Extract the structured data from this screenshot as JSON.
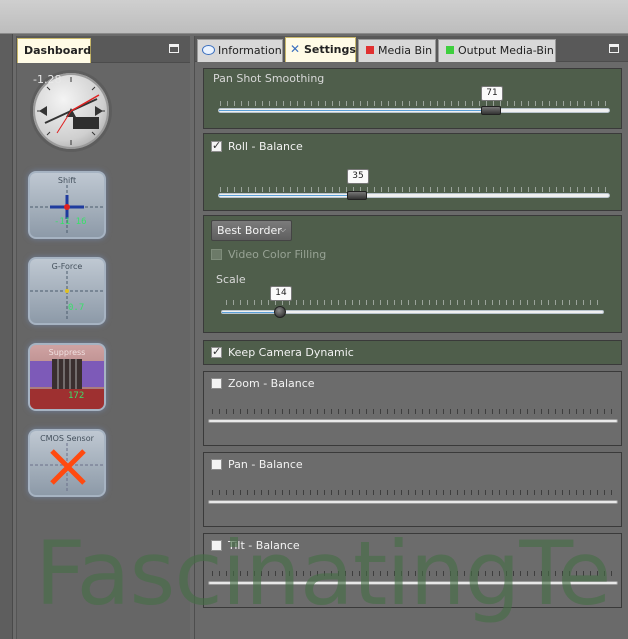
{
  "dashboard": {
    "tab_label": "Dashboard",
    "clock": {
      "digits": "-1.28"
    },
    "gauges": [
      {
        "name": "Shift",
        "digits": "-11 16"
      },
      {
        "name": "G-Force",
        "digits": "0.7"
      },
      {
        "name": "Suppress",
        "digits": "172"
      },
      {
        "name": "CMOS Sensor",
        "digits": ""
      }
    ]
  },
  "tabs": [
    {
      "label": "Information",
      "icon": "speech-bubble-icon"
    },
    {
      "label": "Settings",
      "icon": "tools-icon",
      "active": true
    },
    {
      "label": "Media Bin",
      "icon": "red-square-icon",
      "color": "#e03030"
    },
    {
      "label": "Output Media-Bin",
      "icon": "green-square-icon",
      "color": "#3ecf3e"
    }
  ],
  "settings": {
    "pan_shot": {
      "label": "Pan Shot Smoothing",
      "value": "71"
    },
    "roll": {
      "label": "Roll - Balance",
      "checked": true,
      "value": "35"
    },
    "border": {
      "dropdown": "Best Border",
      "video_fill_label": "Video Color Filling",
      "scale_label": "Scale",
      "value": "14"
    },
    "keep_camera": {
      "label": "Keep Camera Dynamic",
      "checked": true
    },
    "zoom": {
      "label": "Zoom - Balance",
      "checked": false
    },
    "pan": {
      "label": "Pan - Balance",
      "checked": false
    },
    "tilt": {
      "label": "Tilt - Balance",
      "checked": false
    }
  },
  "watermark": "FascinatingTe"
}
